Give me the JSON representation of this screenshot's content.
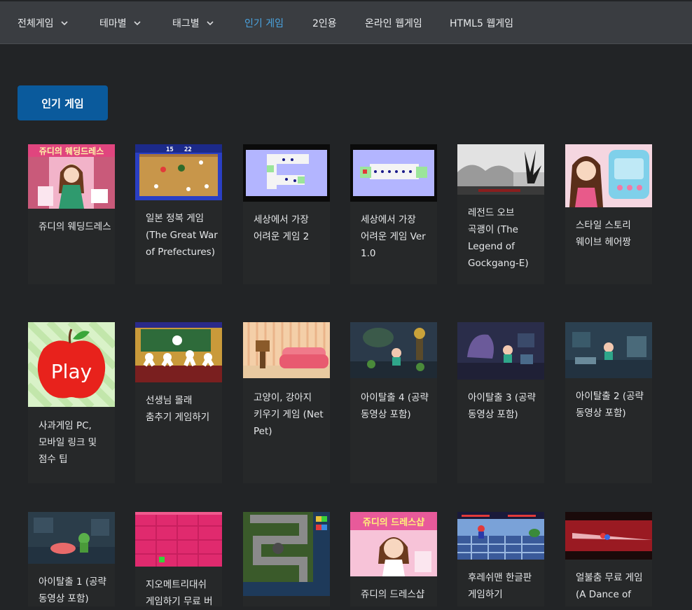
{
  "nav": {
    "items": [
      {
        "label": "전체게임",
        "dropdown": true,
        "active": false
      },
      {
        "label": "테마별",
        "dropdown": true,
        "active": false
      },
      {
        "label": "태그별",
        "dropdown": true,
        "active": false
      },
      {
        "label": "인기 게임",
        "dropdown": false,
        "active": true
      },
      {
        "label": "2인용",
        "dropdown": false,
        "active": false
      },
      {
        "label": "온라인 웹게임",
        "dropdown": false,
        "active": false
      },
      {
        "label": "HTML5 웹게임",
        "dropdown": false,
        "active": false
      }
    ]
  },
  "page": {
    "button_label": "인기 게임"
  },
  "thumb_texts": {
    "apple_play": "Play",
    "judy_wedding_logo": "쥬디의 웨딩드레스",
    "judy_dress_logo": "쥬디의 드레스샵"
  },
  "colors": {
    "accent": "#4aa3df",
    "button": "#0a5a9c",
    "background": "#222426",
    "nav": "#3a3d41"
  },
  "games": [
    {
      "title": "쥬디의 웨딩드레스",
      "thumb": "wedding-dress-thumbnail"
    },
    {
      "title": "일본 정복 게임 (The Great War of Prefectures)",
      "thumb": "japan-map-thumbnail"
    },
    {
      "title": "세상에서 가장 어려운 게임 2",
      "thumb": "hardest-game-2-thumbnail"
    },
    {
      "title": "세상에서 가장 어려운 게임 Ver 1.0",
      "thumb": "hardest-game-1-thumbnail"
    },
    {
      "title": "레전드 오브 곡괭이 (The Legend of Gockgang-E)",
      "thumb": "silhouette-forest-thumbnail"
    },
    {
      "title": "스타일 스토리 웨이브 헤어짱",
      "thumb": "hair-salon-thumbnail"
    },
    {
      "title": "사과게임 PC, 모바일 링크 및 점수 팁",
      "thumb": "apple-play-thumbnail"
    },
    {
      "title": "선생님 몰래 춤추기 게임하기",
      "thumb": "classroom-dance-thumbnail"
    },
    {
      "title": "고양이, 강아지 키우기 게임 (Net Pet)",
      "thumb": "pet-room-thumbnail"
    },
    {
      "title": "아이탈출 4 (공략 동영상 포함)",
      "thumb": "escape-4-thumbnail"
    },
    {
      "title": "아이탈출 3 (공략 동영상 포함)",
      "thumb": "escape-3-thumbnail"
    },
    {
      "title": "아이탈출 2 (공략 동영상 포함)",
      "thumb": "escape-2-thumbnail"
    },
    {
      "title": "아이탈출 1 (공략 동영상 포함)",
      "thumb": "escape-1-thumbnail"
    },
    {
      "title": "지오메트리대쉬 게임하기 무료 버",
      "thumb": "geometry-dash-thumbnail"
    },
    {
      "title": "",
      "thumb": "tower-defense-thumbnail"
    },
    {
      "title": "쥬디의 드레스샵",
      "thumb": "dress-shop-thumbnail"
    },
    {
      "title": "후레쉬맨 한글판 게임하기",
      "thumb": "flashman-thumbnail"
    },
    {
      "title": "얼불춤 무료 게임 (A Dance of",
      "thumb": "dance-of-fire-thumbnail"
    }
  ]
}
